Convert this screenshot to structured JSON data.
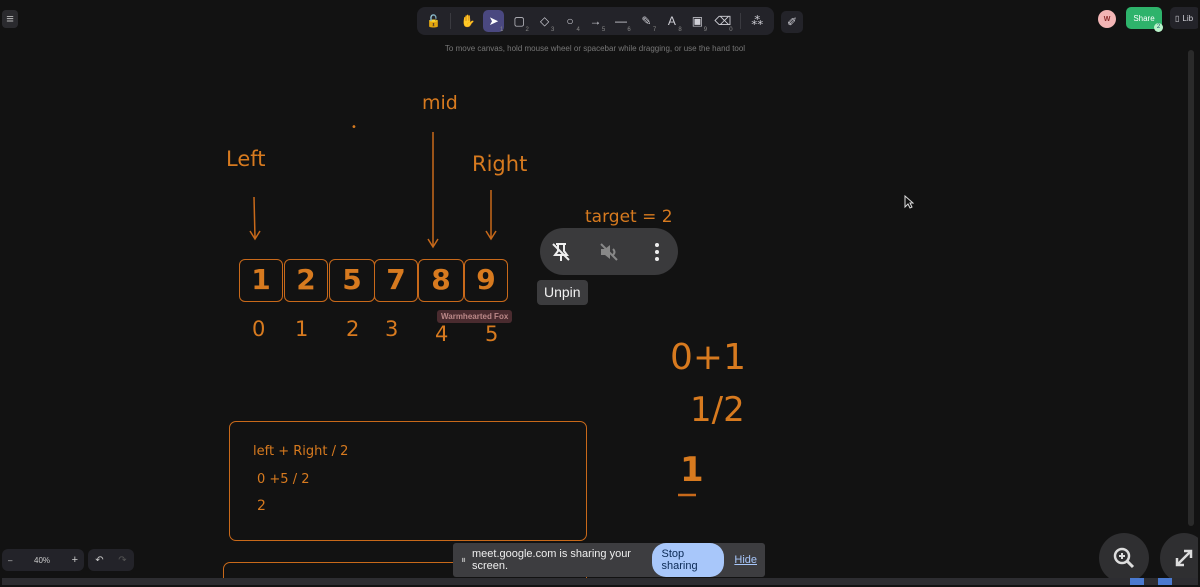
{
  "toolbar": {
    "tools": [
      {
        "name": "lock-tool",
        "glyph": "🔓",
        "key": ""
      },
      {
        "name": "hand-tool",
        "glyph": "✋",
        "key": ""
      },
      {
        "name": "select-tool",
        "glyph": "➤",
        "key": "1"
      },
      {
        "name": "rectangle-tool",
        "glyph": "▢",
        "key": "2"
      },
      {
        "name": "diamond-tool",
        "glyph": "◇",
        "key": "3"
      },
      {
        "name": "ellipse-tool",
        "glyph": "○",
        "key": "4"
      },
      {
        "name": "arrow-tool",
        "glyph": "→",
        "key": "5"
      },
      {
        "name": "line-tool",
        "glyph": "—",
        "key": "6"
      },
      {
        "name": "pencil-tool",
        "glyph": "✎",
        "key": "7"
      },
      {
        "name": "text-tool",
        "glyph": "A",
        "key": "8"
      },
      {
        "name": "image-tool",
        "glyph": "▣",
        "key": "9"
      },
      {
        "name": "eraser-tool",
        "glyph": "⌫",
        "key": "0"
      },
      {
        "name": "more-shapes-tool",
        "glyph": "⁂",
        "key": ""
      }
    ],
    "active": "select-tool"
  },
  "canvas_hint": "To move canvas, hold mouse wheel or spacebar while dragging, or use the hand tool",
  "collab": {
    "avatar_letter": "W",
    "share_label": "Share",
    "share_count": "2",
    "library_label": "Lib"
  },
  "drawing": {
    "left_label": "Left",
    "mid_label": "mid",
    "right_label": "Right",
    "target_label": "target = 2",
    "array_values": [
      "1",
      "2",
      "5",
      "7",
      "8",
      "9"
    ],
    "indices": [
      "0",
      "1",
      "2",
      "3",
      "4",
      "5"
    ],
    "box_lines": [
      "left + Right / 2",
      "0 +5   / 2",
      "2"
    ],
    "calc_top": "0+1",
    "calc_mid": "1/2",
    "calc_result": "1"
  },
  "meet_overlay": {
    "unpin_tooltip": "Unpin",
    "participant_name": "Warmhearted Fox",
    "share_message": "meet.google.com is sharing your screen.",
    "stop_sharing": "Stop sharing",
    "hide": "Hide"
  },
  "zoom": {
    "level": "40%",
    "minus": "–",
    "plus": "+"
  },
  "colors": {
    "ink": "#d77a1f",
    "accent": "#4a4880",
    "share": "#2eb36b",
    "stop_button": "#a8c7fa"
  }
}
